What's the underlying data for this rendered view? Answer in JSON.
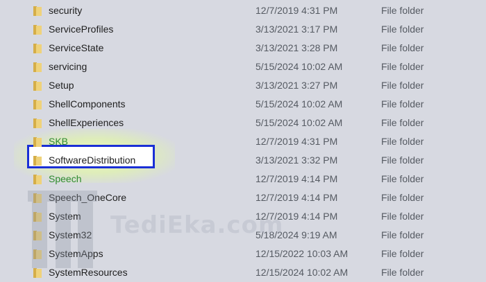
{
  "file_list": {
    "rows": [
      {
        "name": "security",
        "date": "12/7/2019 4:31 PM",
        "type": "File folder",
        "icon": "folder-icon",
        "name_color": "#1e1e1e"
      },
      {
        "name": "ServiceProfiles",
        "date": "3/13/2021 3:17 PM",
        "type": "File folder",
        "icon": "folder-icon",
        "name_color": "#1e1e1e"
      },
      {
        "name": "ServiceState",
        "date": "3/13/2021 3:28 PM",
        "type": "File folder",
        "icon": "folder-icon",
        "name_color": "#1e1e1e"
      },
      {
        "name": "servicing",
        "date": "5/15/2024 10:02 AM",
        "type": "File folder",
        "icon": "folder-icon",
        "name_color": "#1e1e1e"
      },
      {
        "name": "Setup",
        "date": "3/13/2021 3:27 PM",
        "type": "File folder",
        "icon": "folder-icon",
        "name_color": "#1e1e1e"
      },
      {
        "name": "ShellComponents",
        "date": "5/15/2024 10:02 AM",
        "type": "File folder",
        "icon": "folder-icon",
        "name_color": "#1e1e1e"
      },
      {
        "name": "ShellExperiences",
        "date": "5/15/2024 10:02 AM",
        "type": "File folder",
        "icon": "folder-icon",
        "name_color": "#1e1e1e"
      },
      {
        "name": "SKB",
        "date": "12/7/2019 4:31 PM",
        "type": "File folder",
        "icon": "folder-icon",
        "name_color": "#2e8b2e"
      },
      {
        "name": "SoftwareDistribution",
        "date": "3/13/2021 3:32 PM",
        "type": "File folder",
        "icon": "folder-icon",
        "name_color": "#1e1e1e",
        "selected": true
      },
      {
        "name": "Speech",
        "date": "12/7/2019 4:14 PM",
        "type": "File folder",
        "icon": "folder-icon",
        "name_color": "#2e8b2e"
      },
      {
        "name": "Speech_OneCore",
        "date": "12/7/2019 4:14 PM",
        "type": "File folder",
        "icon": "folder-icon",
        "name_color": "#1e1e1e"
      },
      {
        "name": "System",
        "date": "12/7/2019 4:14 PM",
        "type": "File folder",
        "icon": "folder-icon",
        "name_color": "#1e1e1e"
      },
      {
        "name": "System32",
        "date": "5/18/2024 9:19 AM",
        "type": "File folder",
        "icon": "folder-icon",
        "name_color": "#1e1e1e"
      },
      {
        "name": "SystemApps",
        "date": "12/15/2022 10:03 AM",
        "type": "File folder",
        "icon": "folder-icon",
        "name_color": "#1e1e1e"
      },
      {
        "name": "SystemResources",
        "date": "12/15/2024 10:02 AM",
        "type": "File folder",
        "icon": "folder-icon",
        "name_color": "#1e1e1e"
      }
    ]
  },
  "watermark": {
    "text": "TediEka.com",
    "icon": "tediek-logo-icon"
  },
  "colors": {
    "background": "#d7d9e1",
    "selection_border": "#1a2fd6",
    "selection_fill": "#ffffff",
    "folder_yellow": "#e8c56a",
    "green_name": "#2e8b2e"
  }
}
